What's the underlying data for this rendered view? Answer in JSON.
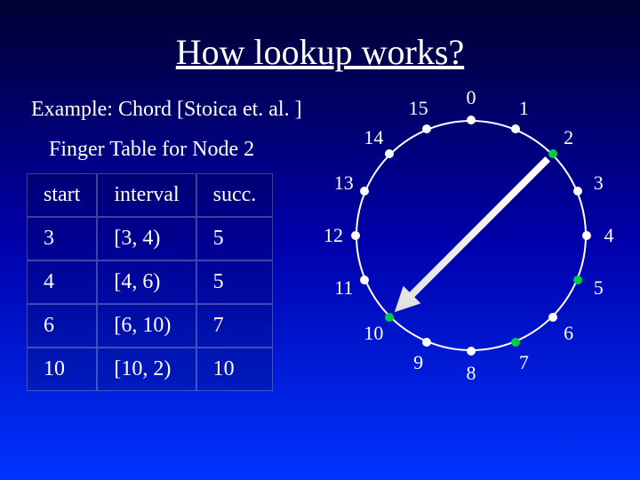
{
  "title": "How lookup works?",
  "example": "Example: Chord [Stoica et. al. ]",
  "subtitle": "Finger Table for Node 2",
  "table": {
    "headers": {
      "start": "start",
      "interval": "interval",
      "succ": "succ."
    },
    "rows": [
      {
        "start": "3",
        "interval": "[3, 4)",
        "succ": "5"
      },
      {
        "start": "4",
        "interval": "[4, 6)",
        "succ": "5"
      },
      {
        "start": "6",
        "interval": "[6, 10)",
        "succ": "7"
      },
      {
        "start": "10",
        "interval": "[10, 2)",
        "succ": "10"
      }
    ]
  },
  "ring": {
    "count": 16,
    "active_nodes": [
      2,
      5,
      7,
      10
    ],
    "arrow": {
      "from": 2,
      "to": 10
    },
    "labels": {
      "0": "0",
      "1": "1",
      "2": "2",
      "3": "3",
      "4": "4",
      "5": "5",
      "6": "6",
      "7": "7",
      "8": "8",
      "9": "9",
      "10": "10",
      "11": "11",
      "12": "12",
      "13": "13",
      "14": "14",
      "15": "15"
    }
  }
}
